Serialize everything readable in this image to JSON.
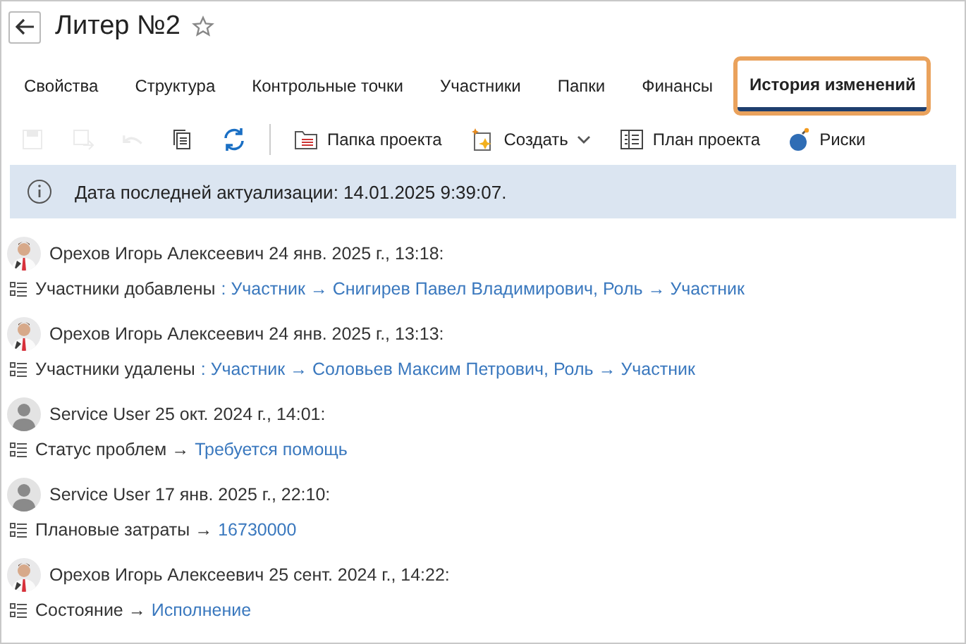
{
  "title": "Литер №2",
  "tabs": [
    {
      "label": "Свойства",
      "selected": false,
      "highlighted": false
    },
    {
      "label": "Структура",
      "selected": false,
      "highlighted": false
    },
    {
      "label": "Контрольные точки",
      "selected": false,
      "highlighted": false
    },
    {
      "label": "Участники",
      "selected": false,
      "highlighted": false
    },
    {
      "label": "Папки",
      "selected": false,
      "highlighted": false
    },
    {
      "label": "Финансы",
      "selected": false,
      "highlighted": false
    },
    {
      "label": "История изменений",
      "selected": true,
      "highlighted": true
    }
  ],
  "toolbar": [
    {
      "kind": "save",
      "disabled": true
    },
    {
      "kind": "save-as",
      "disabled": true
    },
    {
      "kind": "undo",
      "disabled": true
    },
    {
      "kind": "copy",
      "disabled": false
    },
    {
      "kind": "refresh",
      "disabled": false
    },
    {
      "kind": "separator"
    },
    {
      "kind": "folder",
      "label": "Папка проекта",
      "disabled": false
    },
    {
      "kind": "create",
      "label": "Создать",
      "disabled": false
    },
    {
      "kind": "plan",
      "label": "План проекта",
      "disabled": false
    },
    {
      "kind": "risks",
      "label": "Риски",
      "disabled": false
    }
  ],
  "info": "Дата последней актуализации: 14.01.2025 9:39:07.",
  "entries": [
    {
      "author": "Орехов Игорь Алексеевич 24 янв. 2025 г., 13:18:",
      "label": "Участники добавлены",
      "value": ": Участник → Снигирев Павел Владимирович, Роль → Участник"
    },
    {
      "author": "Орехов Игорь Алексеевич 24 янв. 2025 г., 13:13:",
      "label": "Участники удалены",
      "value": ": Участник → Соловьев Максим Петрович, Роль → Участник"
    },
    {
      "kind": "default",
      "author": "Service User 25 окт. 2024 г., 14:01:",
      "label": "Статус проблем →",
      "value": "Требуется помощь"
    },
    {
      "kind": "default",
      "author": "Service User 17 янв. 2025 г., 22:10:",
      "label": "Плановые затраты →",
      "value": "16730000"
    },
    {
      "author": "Орехов Игорь Алексеевич 25 сент. 2024 г., 14:22:",
      "label": "Состояние →",
      "value": "Исполнение"
    }
  ]
}
